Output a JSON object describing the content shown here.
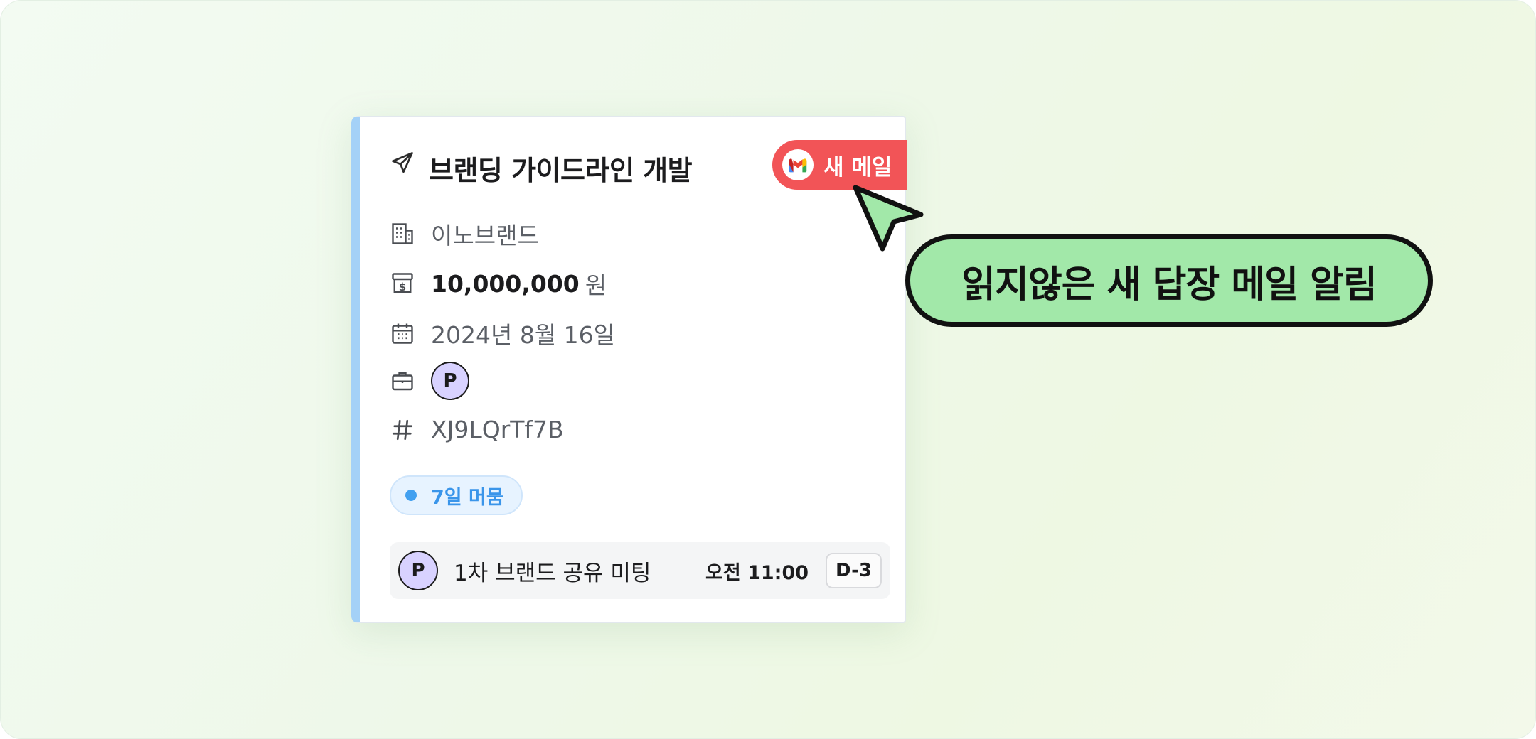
{
  "card": {
    "title": "브랜딩 가이드라인 개발",
    "company": "이노브랜드",
    "amount": "10,000,000",
    "currency_unit": "원",
    "date": "2024년 8월 16일",
    "assignee_initial": "P",
    "code": "XJ9LQrTf7B",
    "stay_badge": "7일 머뭄",
    "accent_color": "#a4d1f7",
    "meeting": {
      "avatar_initial": "P",
      "title": "1차 브랜드 공유 미팅",
      "time": "오전 11:00",
      "dday": "D-3"
    },
    "new_mail_label": "새 메일"
  },
  "callout": {
    "text": "읽지않은 새 답장 메일 알림",
    "color": "#a2e8a9"
  },
  "icons": {
    "title": "paper-plane-icon",
    "company": "building-icon",
    "amount": "money-box-icon",
    "date": "calendar-icon",
    "assignee": "briefcase-icon",
    "code": "hash-icon",
    "mail": "gmail-icon",
    "pointer": "cursor-arrow-icon"
  }
}
